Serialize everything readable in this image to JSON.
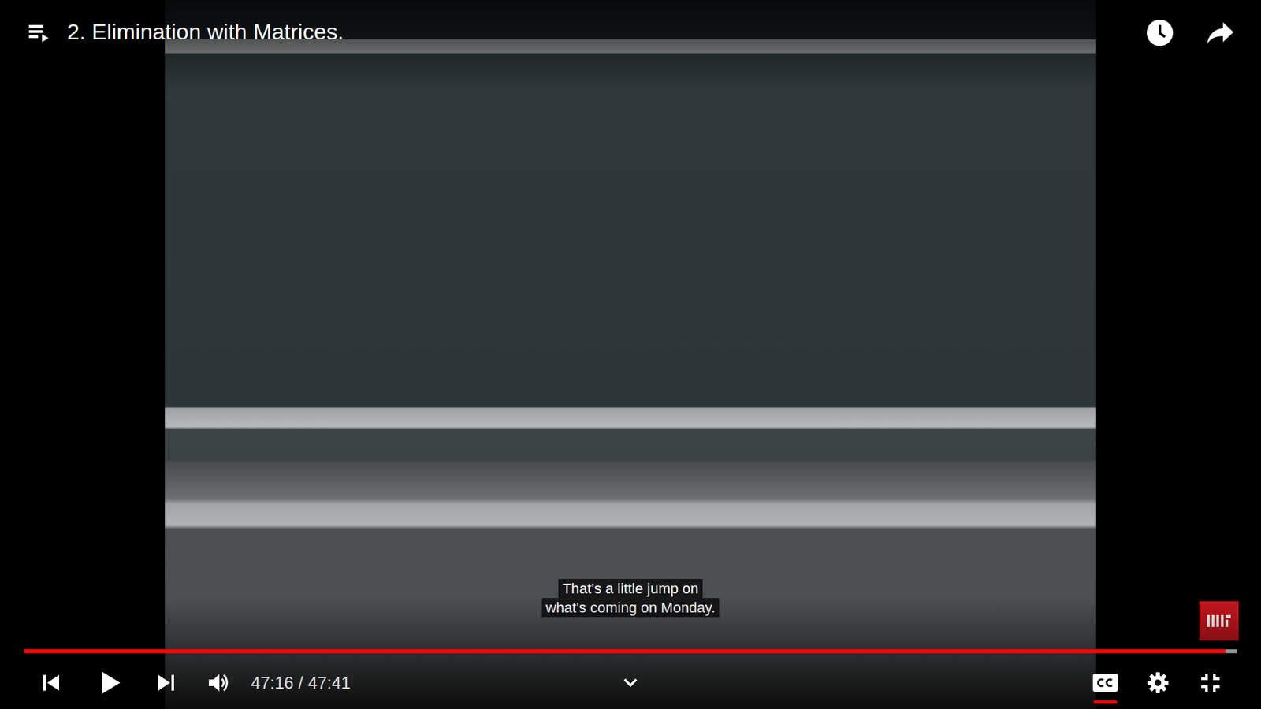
{
  "video": {
    "title": "2. Elimination with Matrices.",
    "captions": [
      "That's a little jump on",
      "what's coming on Monday."
    ]
  },
  "player": {
    "progress": {
      "level": 0.991,
      "buffered": 1.0
    },
    "time": "47:16 / 47:41",
    "captions_on": true,
    "playing": false
  }
}
